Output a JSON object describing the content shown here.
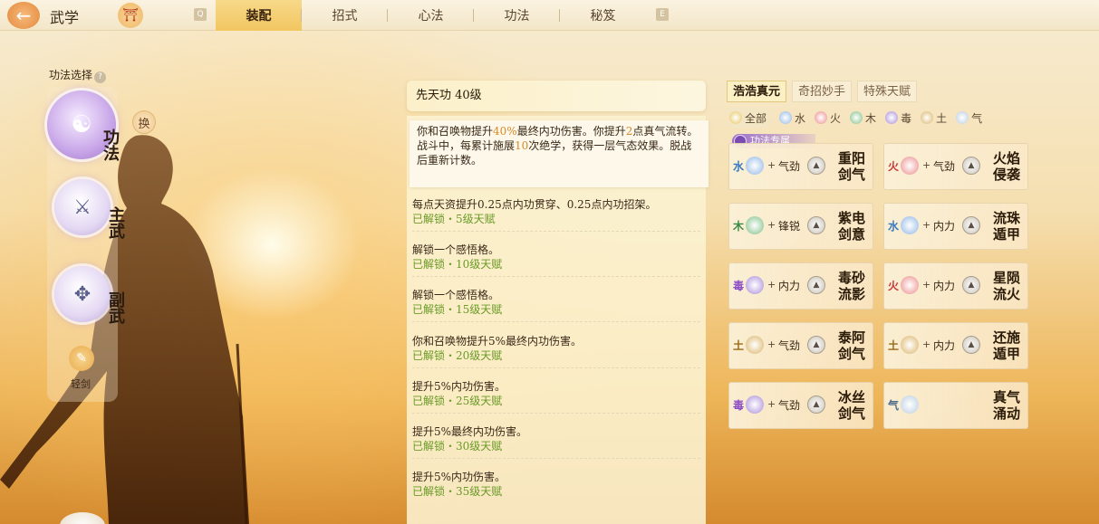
{
  "topbar": {
    "title": "武学",
    "left_key": "Q",
    "right_key": "E",
    "tabs": [
      {
        "label": "装配",
        "active": true
      },
      {
        "label": "招式",
        "active": false
      },
      {
        "label": "心法",
        "active": false
      },
      {
        "label": "功法",
        "active": false
      },
      {
        "label": "秘笈",
        "active": false
      }
    ]
  },
  "left": {
    "section_label": "功法选择",
    "help": "?",
    "swap_label": "换",
    "slot_main_label": "功法",
    "slot_2_label": "主武",
    "slot_3_label": "副武",
    "sword_label": "轻剑"
  },
  "skill": {
    "title": "先天功 40级",
    "desc_parts": [
      "你和召唤物提升",
      "40%",
      "最终内功伤害。你提升",
      "2",
      "点真气流转。"
    ],
    "desc_line2_parts": [
      "战斗中，每累计施展",
      "10",
      "次绝学，获得一层气态效果。脱战后重新计数。"
    ],
    "talents": [
      {
        "text": "每点天资提升0.25点内功贯穿、0.25点内功招架。",
        "status": "已解锁・5级天赋"
      },
      {
        "text": "解锁一个感悟格。",
        "status": "已解锁・10级天赋"
      },
      {
        "text": "解锁一个感悟格。",
        "status": "已解锁・15级天赋"
      },
      {
        "text": "你和召唤物提升5%最终内功伤害。",
        "status": "已解锁・20级天赋"
      },
      {
        "text": "提升5%内功伤害。",
        "status": "已解锁・25级天赋"
      },
      {
        "text": "提升5%最终内功伤害。",
        "status": "已解锁・30级天赋"
      },
      {
        "text": "提升5%内功伤害。",
        "status": "已解锁・35级天赋"
      }
    ]
  },
  "right": {
    "tabs": [
      {
        "label": "浩浩真元",
        "active": true
      },
      {
        "label": "奇招妙手",
        "active": false
      },
      {
        "label": "特殊天赋",
        "active": false
      }
    ],
    "filters": [
      {
        "label": "全部",
        "color": "#e8c45a",
        "active": true
      },
      {
        "label": "水",
        "color": "#8fb6e6",
        "active": false
      },
      {
        "label": "火",
        "color": "#ec8a8a",
        "active": false
      },
      {
        "label": "木",
        "color": "#7fbf86",
        "active": false
      },
      {
        "label": "毒",
        "color": "#a98bd9",
        "active": false
      },
      {
        "label": "土",
        "color": "#d9b366",
        "active": false
      },
      {
        "label": "气",
        "color": "#b9cde0",
        "active": false
      }
    ],
    "exclusive_label": "功法专属",
    "cards": [
      {
        "elem": "水",
        "elem_color": "#3a78c0",
        "ico": "#8fb6e6",
        "stat": "气劲",
        "name": "重阳剑气",
        "has_stat": true
      },
      {
        "elem": "火",
        "elem_color": "#c83a3a",
        "ico": "#ec8a8a",
        "stat": "气劲",
        "name": "火焰侵袭",
        "has_stat": true
      },
      {
        "elem": "木",
        "elem_color": "#3a8a44",
        "ico": "#7fbf86",
        "stat": "锋锐",
        "name": "紫电剑意",
        "has_stat": true
      },
      {
        "elem": "水",
        "elem_color": "#3a78c0",
        "ico": "#8fb6e6",
        "stat": "内力",
        "name": "流珠遁甲",
        "has_stat": true
      },
      {
        "elem": "毒",
        "elem_color": "#8a4cc8",
        "ico": "#a98bd9",
        "stat": "内力",
        "name": "毒砂流影",
        "has_stat": true
      },
      {
        "elem": "火",
        "elem_color": "#c83a3a",
        "ico": "#ec8a8a",
        "stat": "内力",
        "name": "星陨流火",
        "has_stat": true
      },
      {
        "elem": "土",
        "elem_color": "#9a6a1a",
        "ico": "#d9b366",
        "stat": "气劲",
        "name": "泰阿剑气",
        "has_stat": true
      },
      {
        "elem": "土",
        "elem_color": "#9a6a1a",
        "ico": "#d9b366",
        "stat": "内力",
        "name": "还施遁甲",
        "has_stat": true
      },
      {
        "elem": "毒",
        "elem_color": "#8a4cc8",
        "ico": "#a98bd9",
        "stat": "气劲",
        "name": "冰丝剑气",
        "has_stat": true
      },
      {
        "elem": "气",
        "elem_color": "#4a6a8a",
        "ico": "#b9cde0",
        "stat": "",
        "name": "真气涌动",
        "has_stat": false
      }
    ]
  }
}
